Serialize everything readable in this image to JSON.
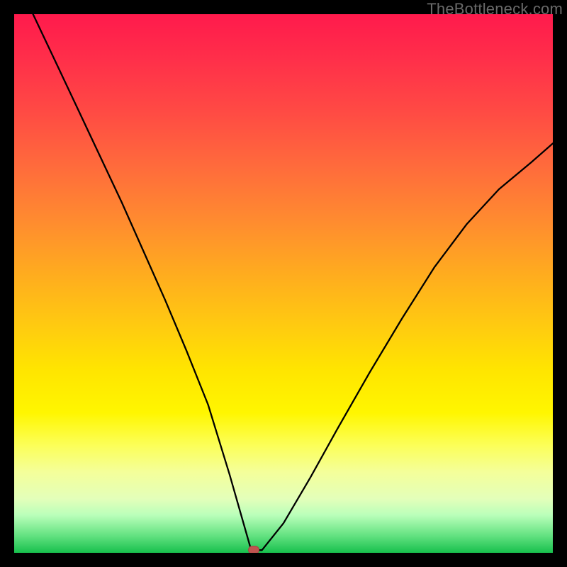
{
  "watermark": "TheBottleneck.com",
  "marker": {
    "x_frac": 0.445,
    "y_frac": 0.995
  },
  "chart_data": {
    "type": "line",
    "title": "",
    "xlabel": "",
    "ylabel": "",
    "xlim": [
      0,
      1
    ],
    "ylim": [
      0,
      1
    ],
    "series": [
      {
        "name": "curve",
        "x": [
          0.035,
          0.08,
          0.12,
          0.16,
          0.2,
          0.24,
          0.28,
          0.32,
          0.36,
          0.4,
          0.42,
          0.44,
          0.46,
          0.5,
          0.55,
          0.6,
          0.66,
          0.72,
          0.78,
          0.84,
          0.9,
          0.96,
          1.0
        ],
        "y": [
          1.0,
          0.905,
          0.82,
          0.735,
          0.65,
          0.56,
          0.47,
          0.375,
          0.275,
          0.145,
          0.075,
          0.005,
          0.005,
          0.055,
          0.14,
          0.23,
          0.335,
          0.435,
          0.53,
          0.61,
          0.675,
          0.725,
          0.76
        ]
      }
    ],
    "marker": {
      "x": 0.445,
      "y": 0.005
    },
    "background_gradient": {
      "top": "#ff1a4c",
      "mid": "#ffe500",
      "bottom": "#17c04d"
    }
  }
}
